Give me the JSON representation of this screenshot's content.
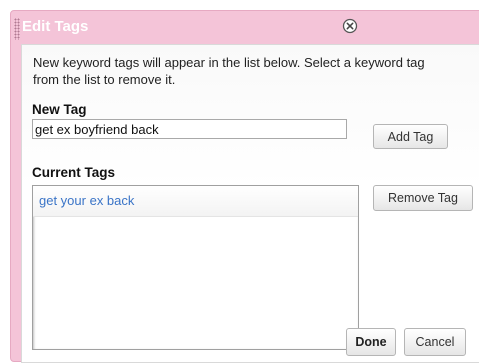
{
  "dialog": {
    "title": "Edit Tags",
    "instructions": "New keyword tags will appear in the list below. Select a keyword tag from the list to remove it.",
    "new_tag_label": "New Tag",
    "new_tag_value": "get ex boyfriend back",
    "add_tag_label": "Add Tag",
    "current_tags_label": "Current Tags",
    "remove_tag_label": "Remove Tag",
    "current_tags": [
      "get your ex back"
    ],
    "done_label": "Done",
    "cancel_label": "Cancel"
  },
  "colors": {
    "title_bar": "#f4c4d8",
    "tag_link": "#3a74c7"
  },
  "icons": {
    "close": "close-circle-x-icon",
    "grip": "drag-grip-icon"
  }
}
